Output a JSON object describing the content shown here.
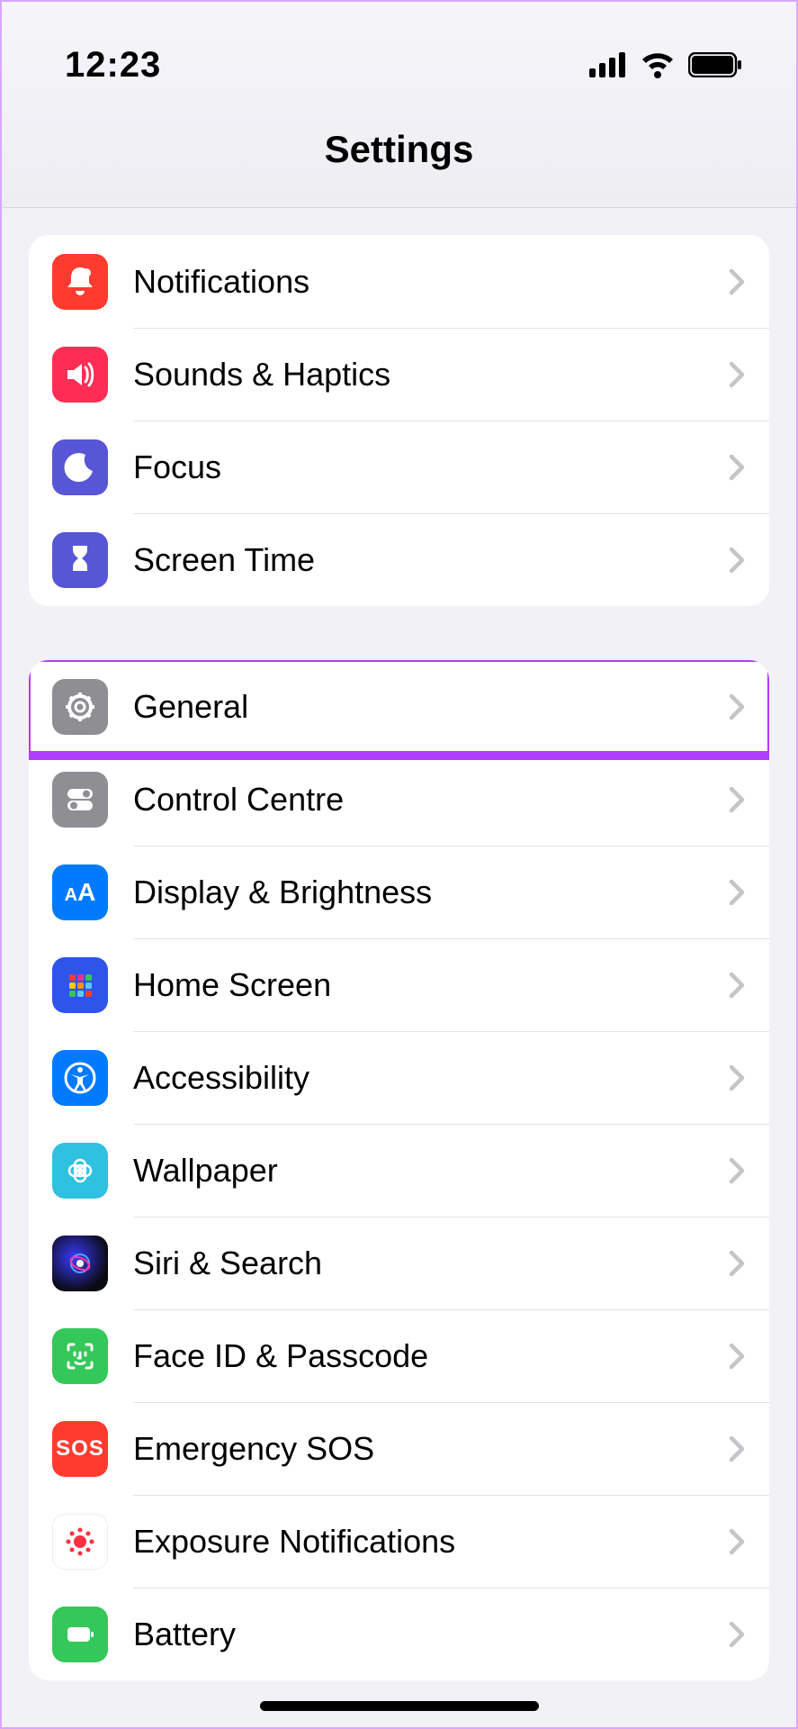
{
  "status": {
    "time": "12:23"
  },
  "header": {
    "title": "Settings"
  },
  "group1": [
    {
      "id": "notifications",
      "label": "Notifications"
    },
    {
      "id": "sounds",
      "label": "Sounds & Haptics"
    },
    {
      "id": "focus",
      "label": "Focus"
    },
    {
      "id": "screentime",
      "label": "Screen Time"
    }
  ],
  "group2": [
    {
      "id": "general",
      "label": "General",
      "highlighted": true
    },
    {
      "id": "controlcentre",
      "label": "Control Centre"
    },
    {
      "id": "display",
      "label": "Display & Brightness"
    },
    {
      "id": "homescreen",
      "label": "Home Screen"
    },
    {
      "id": "accessibility",
      "label": "Accessibility"
    },
    {
      "id": "wallpaper",
      "label": "Wallpaper"
    },
    {
      "id": "siri",
      "label": "Siri & Search"
    },
    {
      "id": "faceid",
      "label": "Face ID & Passcode"
    },
    {
      "id": "sos",
      "label": "Emergency SOS"
    },
    {
      "id": "exposure",
      "label": "Exposure Notifications"
    },
    {
      "id": "battery",
      "label": "Battery"
    }
  ],
  "icons": {
    "sos_text": "SOS",
    "aa_text_small": "A",
    "aa_text_big": "A"
  }
}
